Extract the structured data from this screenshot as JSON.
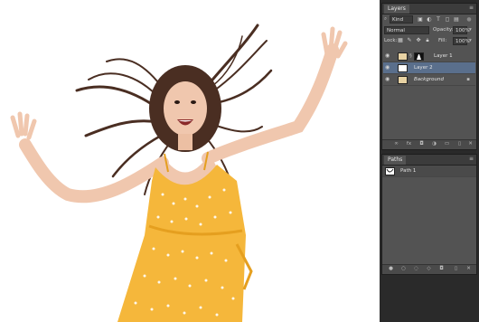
{
  "layers_panel": {
    "tab_label": "Layers",
    "filter_kind": "Kind",
    "blend_mode": "Normal",
    "opacity_label": "Opacity:",
    "opacity_value": "100%",
    "lock_label": "Lock:",
    "fill_label": "Fill:",
    "fill_value": "100%",
    "layers": [
      {
        "name": "Layer 1",
        "selected": false,
        "has_mask": true
      },
      {
        "name": "Layer 2",
        "selected": true,
        "has_mask": false
      },
      {
        "name": "Background",
        "selected": false,
        "has_mask": false,
        "locked": true
      }
    ]
  },
  "paths_panel": {
    "tab_label": "Paths",
    "paths": [
      {
        "name": "Path 1"
      }
    ]
  },
  "colors": {
    "panel_bg": "#535353",
    "selected_row": "#5a6f8c",
    "dress": "#f5b73b",
    "hair": "#4a2e22",
    "skin": "#f0c7ae"
  }
}
